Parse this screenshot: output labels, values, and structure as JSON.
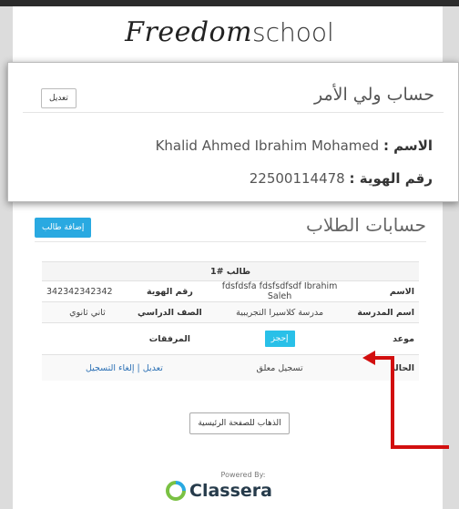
{
  "logo": {
    "script": "Freedom",
    "plain": "school"
  },
  "parent": {
    "title": "حساب ولي الأمر",
    "edit_label": "تعديل",
    "name_label": "الاسم :",
    "name_value": "Khalid Ahmed Ibrahim Mohamed",
    "id_label": "رقم الهوية :",
    "id_value": "22500114478"
  },
  "students": {
    "title": "حسابات الطلاب",
    "add_label": "إضافة طالب",
    "student_header": "طالب #1",
    "rows": {
      "name_label": "الاسم",
      "name_value": "fdsfdsfa fdsfsdfsdf Ibrahim Saleh",
      "id_label": "رقم الهوية",
      "id_value": "342342342342",
      "school_label": "اسم المدرسة",
      "school_value": "مدرسة كلاسيرا التجريبية",
      "grade_label": "الصف الدراسي",
      "grade_value": "ثاني ثانوي",
      "appointment_label": "موعد",
      "book_label": "إحجز",
      "attachments_label": "المرفقات",
      "status_label": "الحالة",
      "status_value": "تسجيل معلق",
      "edit_link": "تعديل",
      "separator": "|",
      "cancel_link": "إلغاء التسجيل"
    }
  },
  "home_button": "الذهاب للصفحة الرئيسية",
  "footer": {
    "powered": "Powered By:",
    "brand": "Classera"
  },
  "colors": {
    "accent": "#29a9e1",
    "annotation": "#d20f0f",
    "brand_green": "#7ac143"
  }
}
